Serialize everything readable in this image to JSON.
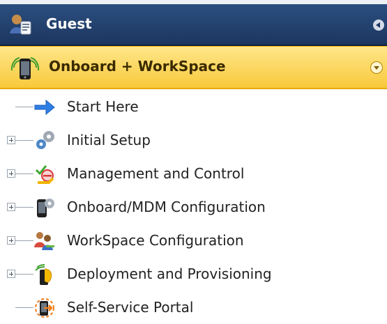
{
  "header": {
    "guest_label": "Guest",
    "section_label": "Onboard + WorkSpace"
  },
  "menu": {
    "items": [
      {
        "label": "Start Here",
        "expandable": false,
        "icon": "arrow-right-icon"
      },
      {
        "label": "Initial Setup",
        "expandable": true,
        "icon": "gears-icon"
      },
      {
        "label": "Management and Control",
        "expandable": true,
        "icon": "management-control-icon"
      },
      {
        "label": "Onboard/MDM Configuration",
        "expandable": true,
        "icon": "device-gear-icon"
      },
      {
        "label": "WorkSpace Configuration",
        "expandable": true,
        "icon": "workspace-users-icon"
      },
      {
        "label": "Deployment and Provisioning",
        "expandable": true,
        "icon": "deploy-wireless-icon"
      },
      {
        "label": "Self-Service Portal",
        "expandable": false,
        "icon": "self-service-portal-icon"
      }
    ]
  },
  "colors": {
    "guest_bar": "#1c365f",
    "onboard_bar": "#f8c93b",
    "text": "#222222"
  }
}
